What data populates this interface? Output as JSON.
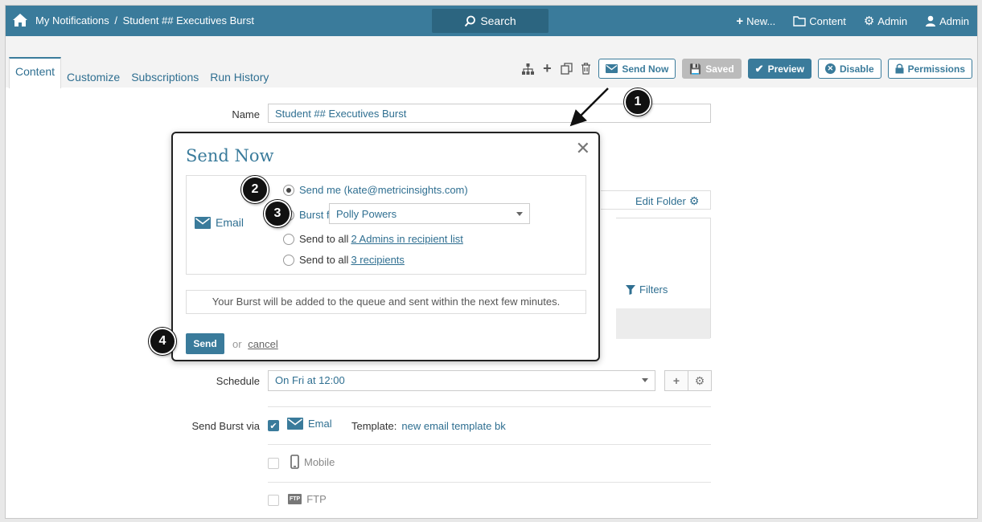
{
  "topbar": {
    "crumb_link": "My Notifications",
    "crumb_sep": "/",
    "crumb_current": "Student ## Executives Burst",
    "search_label": "Search",
    "nav": [
      "New...",
      "Content",
      "Admin",
      "Admin"
    ]
  },
  "tabs": [
    "Content",
    "Customize",
    "Subscriptions",
    "Run History"
  ],
  "toolbar": {
    "send_now": "Send Now",
    "saved": "Saved",
    "preview": "Preview",
    "disable": "Disable",
    "permissions": "Permissions"
  },
  "form": {
    "name_label": "Name",
    "name_value": "Student ## Executives Burst",
    "edit_folder": "Edit Folder",
    "filters": "Filters",
    "schedule_label": "Schedule",
    "schedule_value": "On Fri at 12:00",
    "send_via_label": "Send Burst via",
    "email_label": "Emal",
    "template_label": "Template:",
    "template_value": "new email template bk",
    "mobile_label": "Mobile",
    "ftp_label": "FTP",
    "ftp_badge": "FTP"
  },
  "modal": {
    "title": "Send Now",
    "email_label": "Email",
    "opt_send_me": "Send me (kate@metricinsights.com)",
    "opt_burst_for": "Burst for",
    "burst_select": "Polly Powers",
    "opt_send_all_prefix": "Send to all",
    "opt_admins_link": "2 Admins in recipient list",
    "opt_recipients_link": "3 recipients",
    "note": "Your Burst will be added to the queue and sent within the next few minutes.",
    "send_button": "Send",
    "or": "or",
    "cancel": "cancel"
  },
  "callouts": [
    "1",
    "2",
    "3",
    "4"
  ],
  "colors": {
    "primary": "#3a7b9b",
    "link": "#2f6f91",
    "callout": "#111111"
  }
}
